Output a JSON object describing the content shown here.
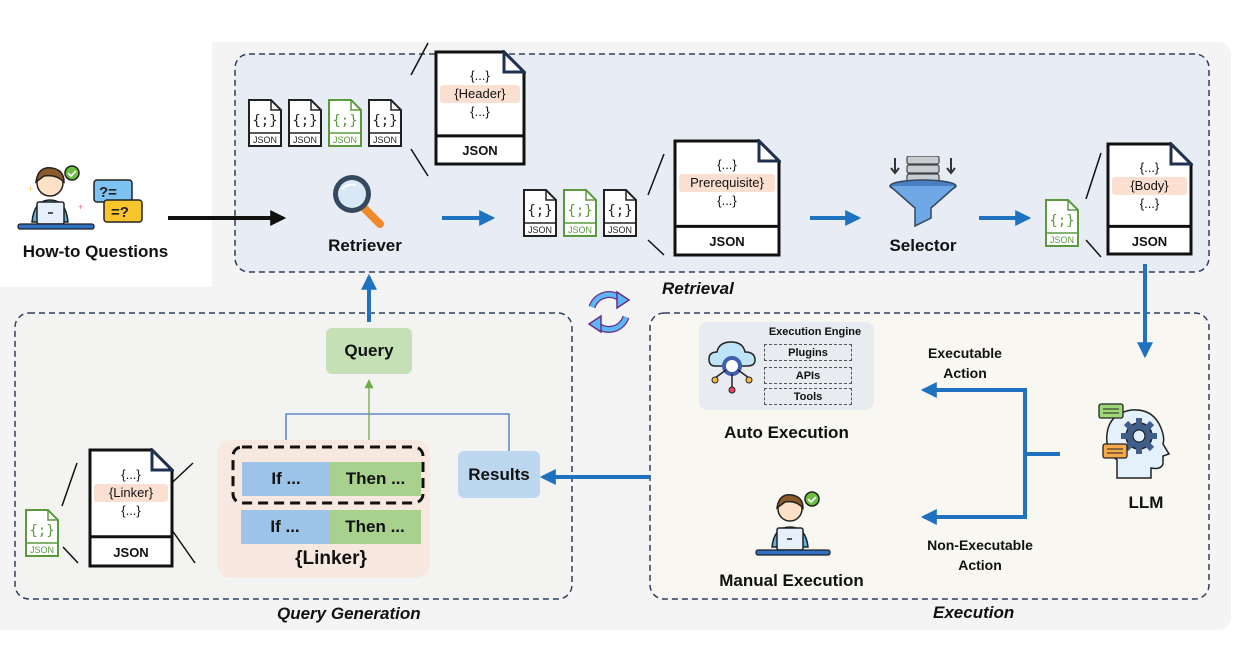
{
  "input": {
    "label": "How-to Questions"
  },
  "retrieval": {
    "title": "Retrieval",
    "retriever_label": "Retriever",
    "selector_label": "Selector",
    "small_doc_label": "JSON",
    "small_doc_glyph": "{;}",
    "header_doc": {
      "top": "{...}",
      "highlight": "{Header}",
      "bottom": "{...}",
      "footer": "JSON"
    },
    "prerequisite_doc": {
      "top": "{...}",
      "highlight": "Prerequisite}",
      "bottom": "{...}",
      "footer": "JSON"
    },
    "body_doc": {
      "top": "{...}",
      "highlight": "{Body}",
      "bottom": "{...}",
      "footer": "JSON"
    }
  },
  "query_generation": {
    "title": "Query Generation",
    "query_label": "Query",
    "results_label": "Results",
    "linker_doc": {
      "top": "{...}",
      "highlight": "{Linker}",
      "bottom": "{...}",
      "footer": "JSON"
    },
    "linker_rows": [
      {
        "if": "If ...",
        "then": "Then ..."
      },
      {
        "if": "If ...",
        "then": "Then ..."
      }
    ],
    "linker_label": "{Linker}"
  },
  "execution": {
    "title": "Execution",
    "engine_title": "Execution Engine",
    "engine_items": [
      "Plugins",
      "APIs",
      "Tools"
    ],
    "auto_label": "Auto Execution",
    "manual_label": "Manual Execution",
    "executable_label_1": "Executable",
    "executable_label_2": "Action",
    "nonexec_label_1": "Non-Executable",
    "nonexec_label_2": "Action",
    "llm_label": "LLM"
  },
  "colors": {
    "arrow_blue": "#1f72c0",
    "json_green": "#5a9a3c",
    "dash_navy": "#2f3f5f",
    "retrieval_bg": "#e8edf5",
    "execution_bg": "#f8f7f1",
    "query_bg": "#f3f4f2",
    "outer_bg": "#f4f4f5"
  }
}
